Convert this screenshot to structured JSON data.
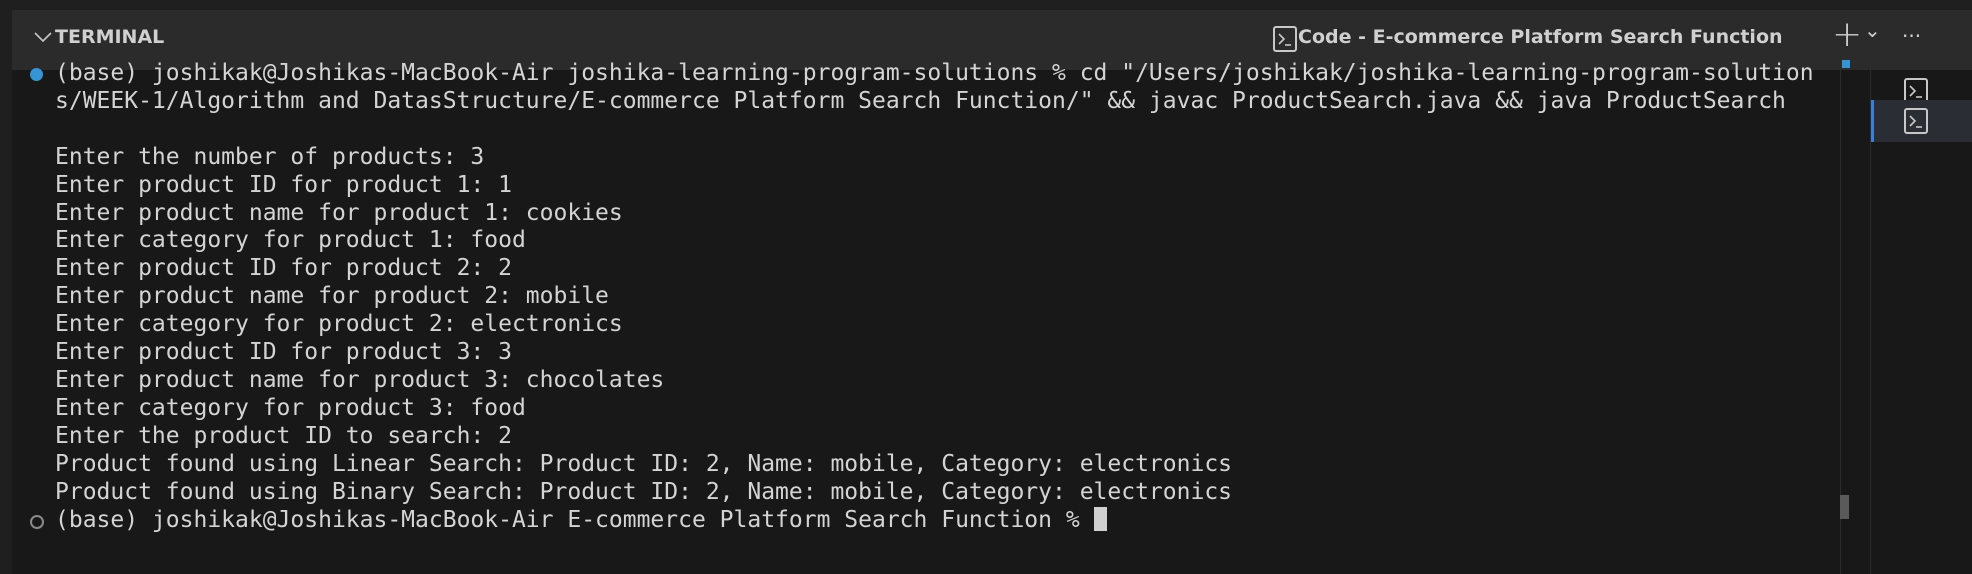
{
  "header": {
    "title": "TERMINAL",
    "terminal_name": "Code - E-commerce Platform Search Function",
    "new_terminal_label": "+",
    "dropdown_label": "⌄",
    "more_label": "···"
  },
  "terminal": {
    "lines": [
      "(base) joshikak@Joshikas-MacBook-Air joshika-learning-program-solutions % cd \"/Users/joshikak/joshika-learning-program-solution",
      "s/WEEK-1/Algorithm and DatasStructure/E-commerce Platform Search Function/\" && javac ProductSearch.java && java ProductSearch",
      "",
      "Enter the number of products: 3",
      "Enter product ID for product 1: 1",
      "Enter product name for product 1: cookies",
      "Enter category for product 1: food",
      "Enter product ID for product 2: 2",
      "Enter product name for product 2: mobile",
      "Enter category for product 2: electronics",
      "Enter product ID for product 3: 3",
      "Enter product name for product 3: chocolates",
      "Enter category for product 3: food",
      "Enter the product ID to search: 2",
      "Product found using Linear Search: Product ID: 2, Name: mobile, Category: electronics",
      "Product found using Binary Search: Product ID: 2, Name: mobile, Category: electronics"
    ],
    "prompt": "(base) joshikak@Joshikas-MacBook-Air E-commerce Platform Search Function % "
  },
  "colors": {
    "accent": "#3d7fd6",
    "success_dot": "#3794d4",
    "idle_dot": "#8a8a8a",
    "background": "#181818"
  }
}
